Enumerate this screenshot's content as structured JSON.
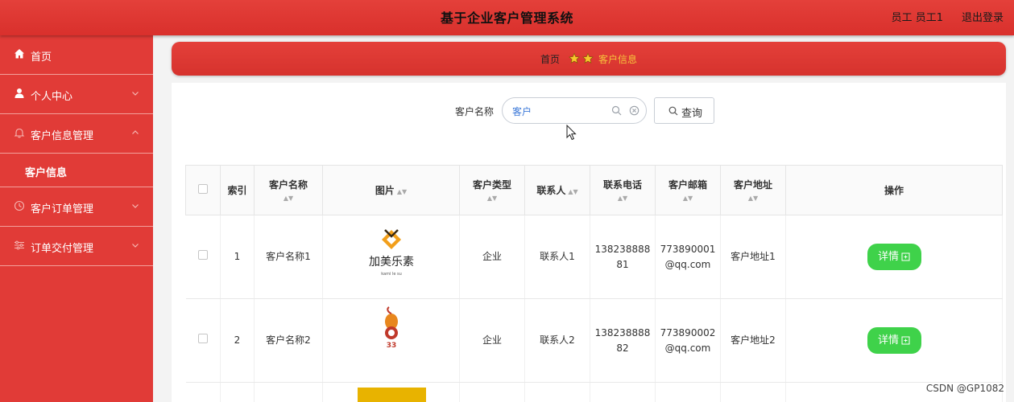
{
  "header": {
    "title": "基于企业客户管理系统",
    "user": "员工 员工1",
    "logout": "退出登录"
  },
  "sidebar": {
    "home": "首页",
    "personal": "个人中心",
    "customer_mgmt": "客户信息管理",
    "customer_info": "客户信息",
    "order_mgmt": "客户订单管理",
    "delivery_mgmt": "订单交付管理"
  },
  "breadcrumb": {
    "home": "首页",
    "current": "客户信息"
  },
  "search": {
    "label": "客户名称",
    "value": "客户",
    "button": "查询"
  },
  "table": {
    "headers": {
      "index": "索引",
      "name": "客户名称",
      "image": "图片",
      "type": "客户类型",
      "contact": "联系人",
      "phone": "联系电话",
      "email": "客户邮箱",
      "address": "客户地址",
      "action": "操作"
    },
    "rows": [
      {
        "index": "1",
        "name": "客户名称1",
        "logo_text": "加美乐素",
        "logo_sub": "kami le su",
        "type": "企业",
        "contact": "联系人1",
        "phone_l1": "138238888",
        "phone_l2": "81",
        "email_l1": "773890001",
        "email_l2": "@qq.com",
        "address": "客户地址1",
        "action": "详情"
      },
      {
        "index": "2",
        "name": "客户名称2",
        "logo_text": "33",
        "logo_sub": "",
        "type": "企业",
        "contact": "联系人2",
        "phone_l1": "138238888",
        "phone_l2": "82",
        "email_l1": "773890002",
        "email_l2": "@qq.com",
        "address": "客户地址2",
        "action": "详情"
      }
    ]
  },
  "watermark": "CSDN @GP1082",
  "colors": {
    "primary": "#e13b37",
    "accent_green": "#3fd24a",
    "breadcrumb_current": "#f6c33c"
  }
}
